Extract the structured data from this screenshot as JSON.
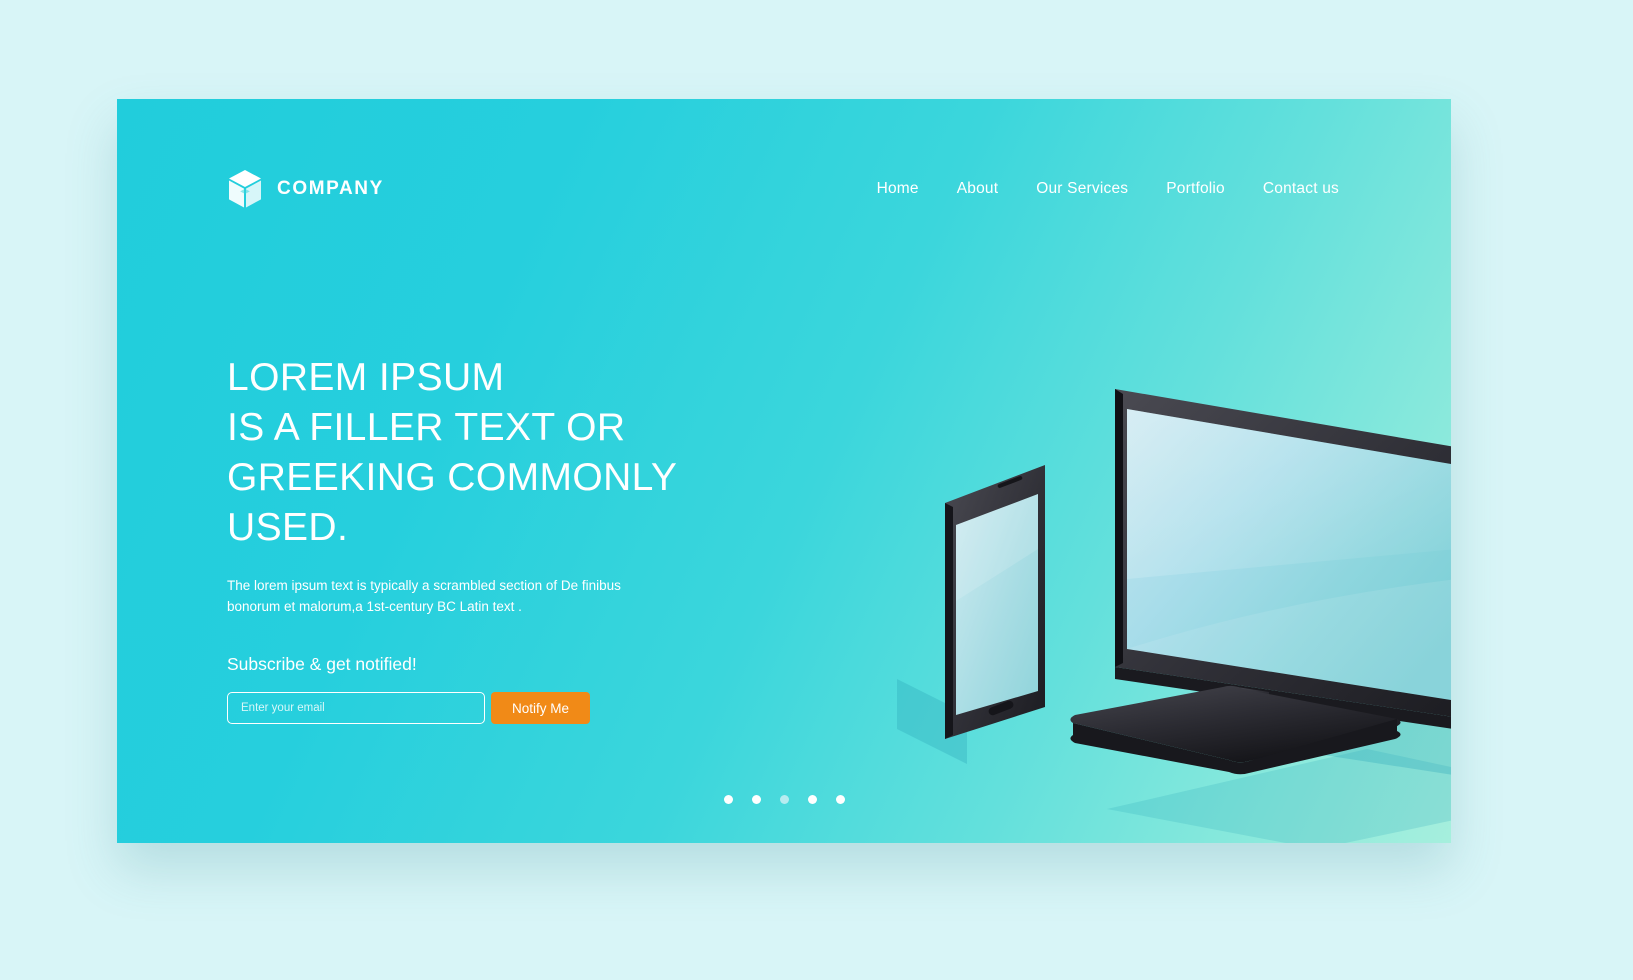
{
  "page": {
    "background_color": "#d8f5f7",
    "card_gradient_from": "#21cddc",
    "card_gradient_to": "#a6efdd",
    "accent_color": "#f18a17"
  },
  "header": {
    "logo_icon": "cube-icon",
    "brand_name": "COMPANY",
    "nav": [
      {
        "label": "Home"
      },
      {
        "label": "About"
      },
      {
        "label": "Our Services"
      },
      {
        "label": "Portfolio"
      },
      {
        "label": "Contact us"
      }
    ]
  },
  "hero": {
    "heading": "LOREM IPSUM\nIS A FILLER TEXT OR\nGREEKING COMMONLY\nUSED.",
    "subtext": "The lorem ipsum text is typically a scrambled section of De finibus\nbonorum et malorum,a 1st-century BC Latin text .",
    "subscribe_label": "Subscribe & get notified!",
    "email_placeholder": "Enter your email",
    "email_value": "",
    "notify_button_label": "Notify Me"
  },
  "carousel": {
    "total_dots": 5,
    "active_index": 0,
    "dots": [
      {
        "state": "active"
      },
      {
        "state": "active"
      },
      {
        "state": "inactive"
      },
      {
        "state": "active"
      },
      {
        "state": "active"
      }
    ]
  },
  "illustration": {
    "name": "isometric-devices-illustration",
    "devices": [
      "tablet-device",
      "monitor-device"
    ],
    "screen_color_light": "#bfe7ee",
    "screen_color_mid": "#8fd9dc",
    "bezel_color": "#2e2e33"
  }
}
